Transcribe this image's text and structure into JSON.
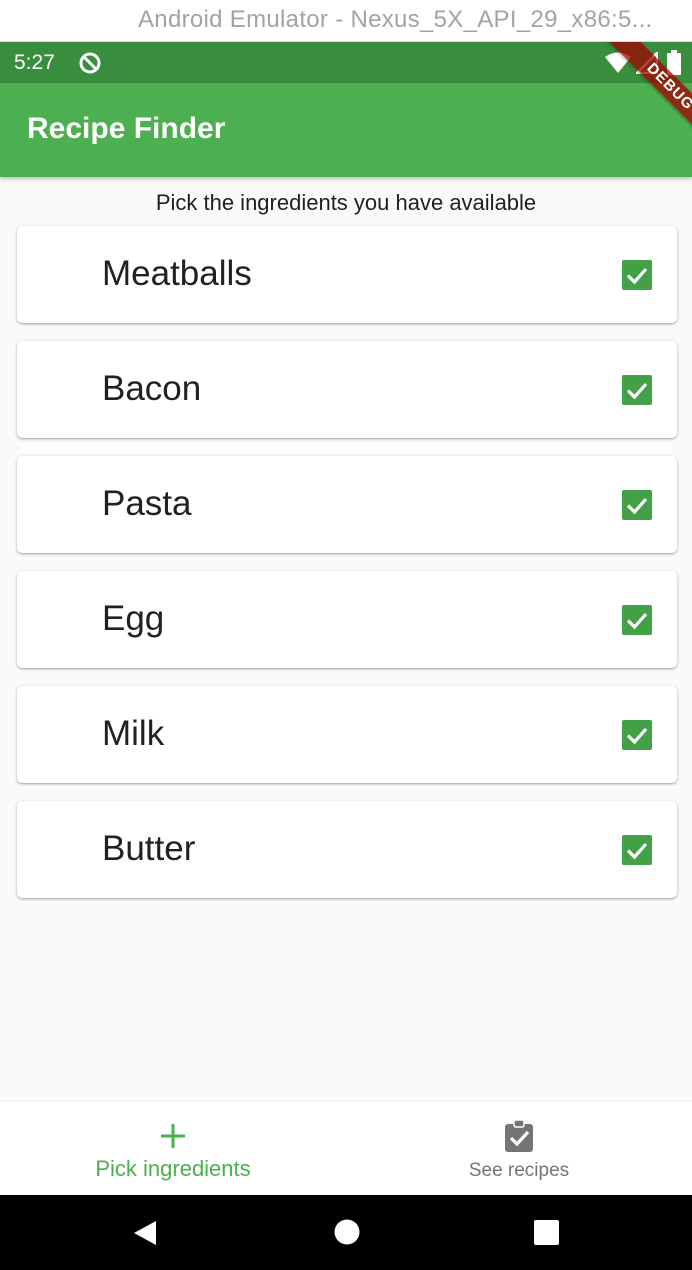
{
  "window": {
    "title": "Android Emulator - Nexus_5X_API_29_x86:5..."
  },
  "status_bar": {
    "time": "5:27",
    "icons": [
      "sync-icon",
      "wifi-icon",
      "signal-icon",
      "battery-icon"
    ]
  },
  "debug_banner": {
    "label": "DEBUG"
  },
  "app_bar": {
    "title": "Recipe Finder"
  },
  "main": {
    "instruction": "Pick the ingredients you have available",
    "ingredients": [
      {
        "name": "Meatballs",
        "checked": true
      },
      {
        "name": "Bacon",
        "checked": true
      },
      {
        "name": "Pasta",
        "checked": true
      },
      {
        "name": "Egg",
        "checked": true
      },
      {
        "name": "Milk",
        "checked": true
      },
      {
        "name": "Butter",
        "checked": true
      }
    ]
  },
  "bottom_nav": {
    "items": [
      {
        "label": "Pick ingredients",
        "icon": "plus-icon",
        "selected": true
      },
      {
        "label": "See recipes",
        "icon": "clipboard-check-icon",
        "selected": false
      }
    ]
  },
  "system_nav": {
    "icons": [
      "back-icon",
      "home-icon",
      "recents-icon"
    ]
  },
  "colors": {
    "primary": "#4caf50",
    "primary_dark": "#388e3c",
    "checkbox": "#43a047",
    "inactive": "#757575"
  }
}
